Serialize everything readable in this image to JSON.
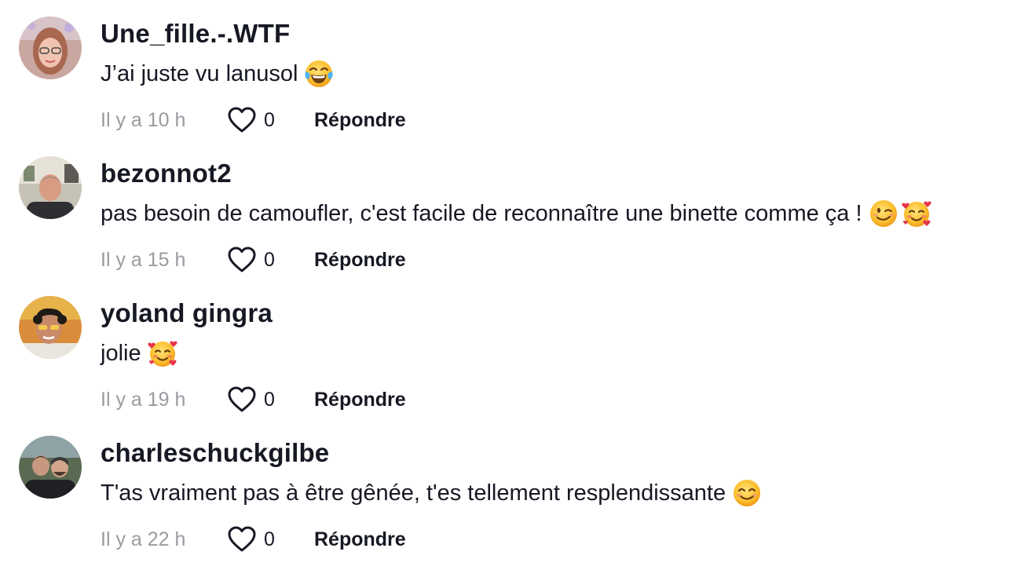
{
  "comments": [
    {
      "username": "Une_fille.-.WTF",
      "text": "J’ai juste vu lanusol",
      "emojis": [
        "face-with-tears-of-joy-emoji"
      ],
      "time": "Il y a 10 h",
      "likes": "0",
      "reply_label": "Répondre"
    },
    {
      "username": "bezonnot2",
      "text": "pas besoin de camoufler, c'est facile de reconnaître une binette comme ça !",
      "emojis": [
        "winking-face-emoji",
        "smiling-face-with-hearts-emoji"
      ],
      "time": "Il y a 15 h",
      "likes": "0",
      "reply_label": "Répondre"
    },
    {
      "username": "yoland gingra",
      "text": "jolie",
      "emojis": [
        "smiling-face-with-hearts-emoji"
      ],
      "time": "Il y a 19 h",
      "likes": "0",
      "reply_label": "Répondre"
    },
    {
      "username": "charleschuckgilbe",
      "text": "T'as vraiment pas à être gênée, t'es tellement resplendissante",
      "emojis": [
        "smiling-face-with-smiling-eyes-emoji"
      ],
      "time": "Il y a 22 h",
      "likes": "0",
      "reply_label": "Répondre"
    }
  ],
  "icons": {
    "like": "heart-outline-icon"
  },
  "colors": {
    "text": "#161823",
    "muted": "#9a9ba0",
    "background": "#ffffff"
  }
}
